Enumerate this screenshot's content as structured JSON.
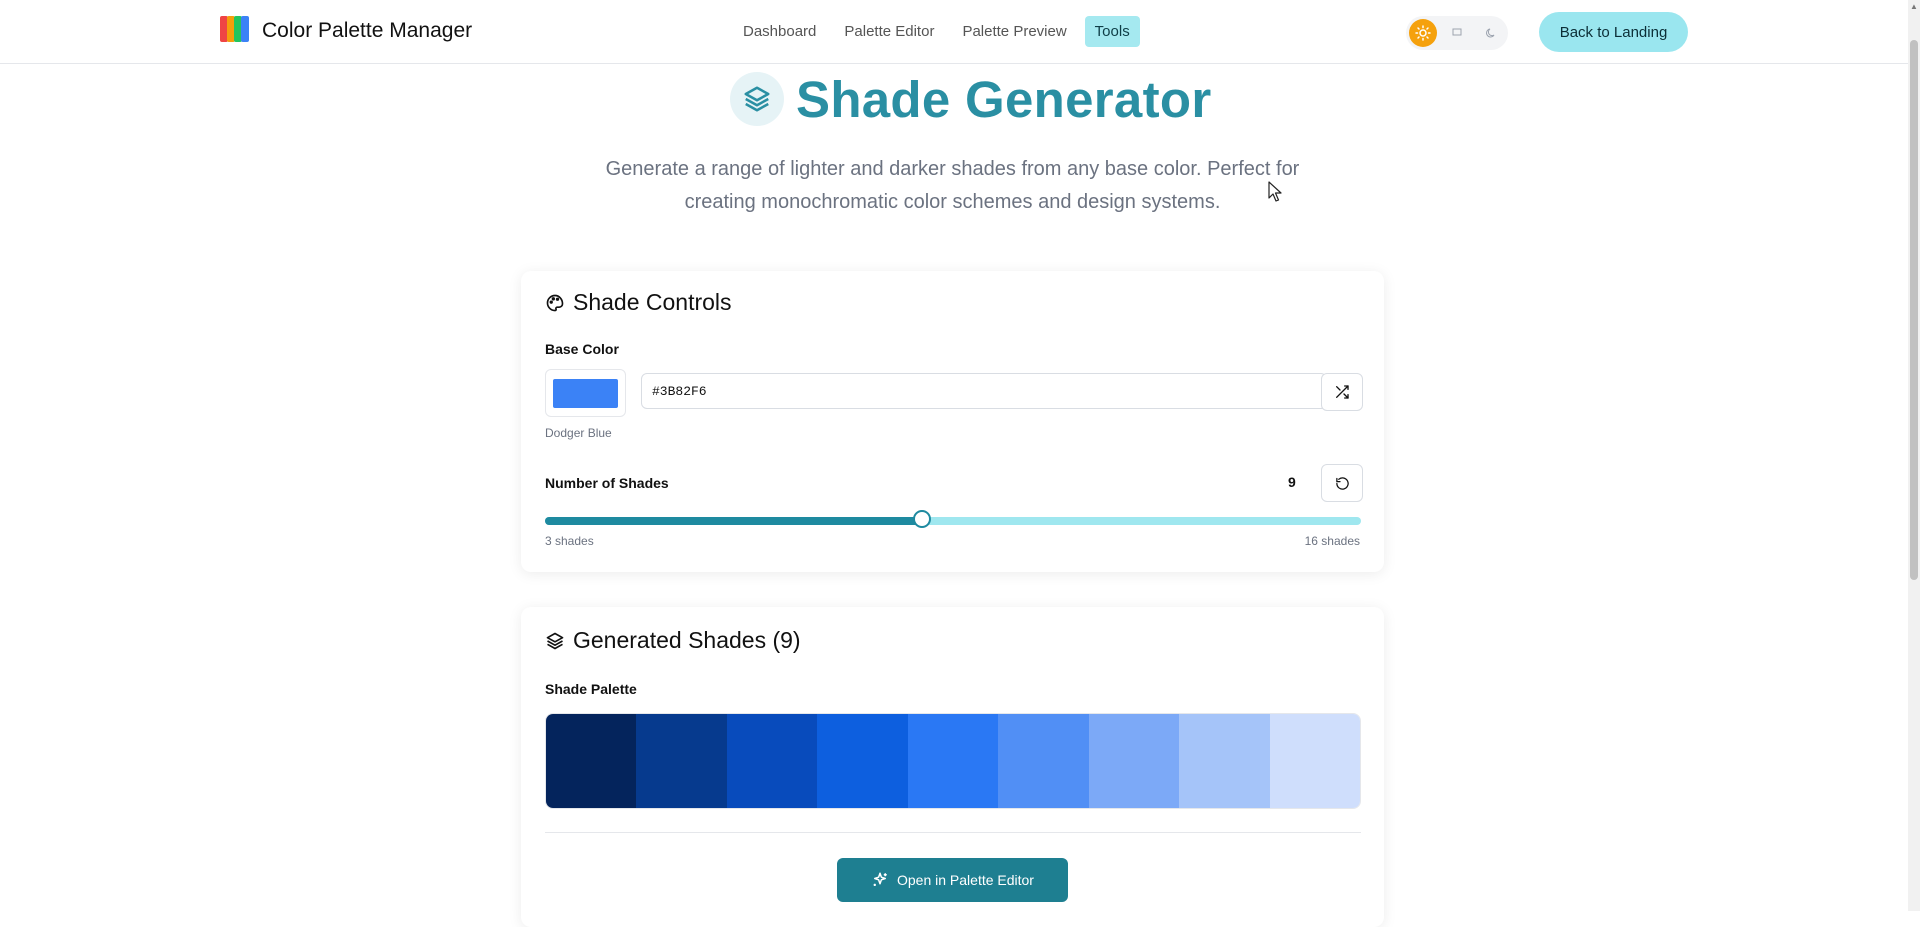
{
  "header": {
    "brand": "Color Palette Manager",
    "nav": [
      "Dashboard",
      "Palette Editor",
      "Palette Preview",
      "Tools"
    ],
    "active_nav": "Tools",
    "back_button": "Back to Landing",
    "theme_options": [
      "sun-icon",
      "monitor-icon",
      "moon-icon"
    ],
    "active_theme": "light"
  },
  "hero": {
    "title": "Shade Generator",
    "subtitle": "Generate a range of lighter and darker shades from any base color. Perfect for creating monochromatic color schemes and design systems."
  },
  "controls": {
    "title": "Shade Controls",
    "base_color_label": "Base Color",
    "base_color_hex": "#3B82F6",
    "base_color_name": "Dodger Blue",
    "shades_label": "Number of Shades",
    "shades_value": "9",
    "slider_min": 3,
    "slider_max": 16,
    "slider_current": 9,
    "min_label": "3 shades",
    "max_label": "16 shades"
  },
  "results": {
    "title": "Generated Shades (9)",
    "palette_label": "Shade Palette",
    "shades": [
      "#04245c",
      "#063a8e",
      "#084bbc",
      "#0d5fdf",
      "#2a78f4",
      "#518ff5",
      "#7ca9f7",
      "#a5c4f9",
      "#cfdefc"
    ],
    "open_button": "Open in Palette Editor"
  },
  "colors": {
    "accent": "#2a8fa3",
    "nav_active": "#a5e9f0",
    "back_button": "#9ae6ef",
    "slider": "#1e8aa0",
    "primary_button": "#1e7f91",
    "sun": "#f5a10d"
  }
}
